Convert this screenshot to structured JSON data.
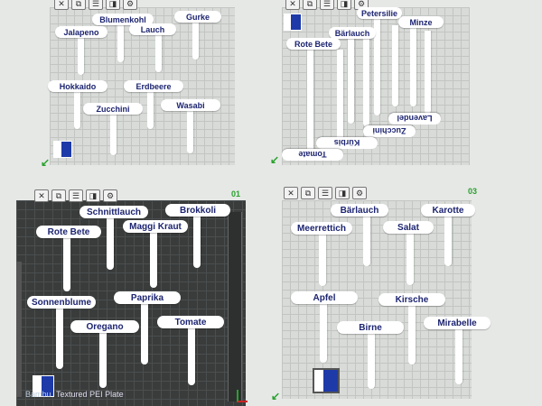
{
  "top_left": {
    "toolbar_icons": [
      "close-icon",
      "copy-icon",
      "list-icon",
      "toggle-icon",
      "gear-icon"
    ],
    "labels": [
      "Blumenkohl",
      "Gurke",
      "Jalapeno",
      "Lauch",
      "Hokkaido",
      "Erdbeere",
      "Zucchini",
      "Wasabi"
    ]
  },
  "top_right": {
    "toolbar_icons": [
      "close-icon",
      "copy-icon",
      "list-icon",
      "toggle-icon",
      "gear-icon"
    ],
    "labels": [
      "Petersilie",
      "Minze",
      "Bärlauch",
      "Rote Bete",
      "Lavendel",
      "Zucchini",
      "Kürbis",
      "Tomate"
    ]
  },
  "bottom_left": {
    "plate_number": "01",
    "toolbar_icons": [
      "close-icon",
      "copy-icon",
      "list-icon",
      "toggle-icon",
      "gear-icon"
    ],
    "labels": [
      "Schnittlauch",
      "Brokkoli",
      "Rote Bete",
      "Maggi Kraut",
      "Sonnenblume",
      "Paprika",
      "Oregano",
      "Tomate"
    ],
    "plate_caption": "Textured PEI Plate",
    "bambu_label": "Bambu"
  },
  "bottom_right": {
    "plate_number": "03",
    "toolbar_icons": [
      "close-icon",
      "copy-icon",
      "list-icon",
      "toggle-icon",
      "gear-icon"
    ],
    "labels": [
      "Bärlauch",
      "Karotte",
      "Meerrettich",
      "Salat",
      "Apfel",
      "Kirsche",
      "Birne",
      "Mirabelle"
    ]
  },
  "colors": {
    "label_text": "#1c2470",
    "accent_green": "#2aa12e",
    "flag_blue": "#1e3aa8"
  }
}
